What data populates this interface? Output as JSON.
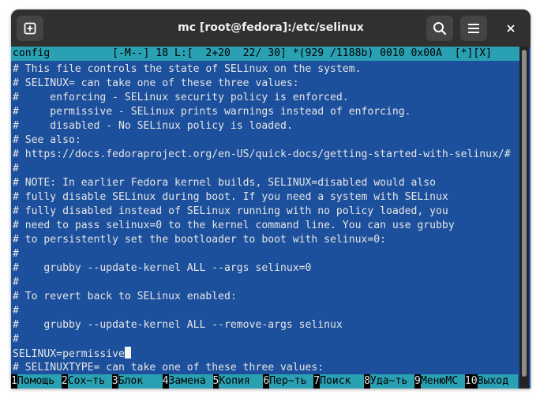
{
  "window": {
    "title": "mc [root@fedora]:/etc/selinux",
    "icons": {
      "new_tab": "new-tab-icon",
      "search": "search-icon",
      "menu": "hamburger-menu-icon",
      "close": "close-icon"
    }
  },
  "editor": {
    "status_line": "config          [-M--] 18 L:[  2+20  22/ 30] *(929 /1188b) 0010 0x00A  [*][X]",
    "lines": [
      "# This file controls the state of SELinux on the system.",
      "# SELINUX= can take one of these three values:",
      "#     enforcing - SELinux security policy is enforced.",
      "#     permissive - SELinux prints warnings instead of enforcing.",
      "#     disabled - No SELinux policy is loaded.",
      "# See also:",
      "# https://docs.fedoraproject.org/en-US/quick-docs/getting-started-with-selinux/#",
      "#",
      "# NOTE: In earlier Fedora kernel builds, SELINUX=disabled would also",
      "# fully disable SELinux during boot. If you need a system with SELinux",
      "# fully disabled instead of SELinux running with no policy loaded, you",
      "# need to pass selinux=0 to the kernel command line. You can use grubby",
      "# to persistently set the bootloader to boot with selinux=0:",
      "#",
      "#    grubby --update-kernel ALL --args selinux=0",
      "#",
      "# To revert back to SELinux enabled:",
      "#",
      "#    grubby --update-kernel ALL --remove-args selinux",
      "#",
      "SELINUX=permissive",
      "# SELINUXTYPE= can take one of these three values:"
    ],
    "cursor_line_index": 20
  },
  "function_keys": [
    {
      "num": "1",
      "label": "Помощь"
    },
    {
      "num": "2",
      "label": "Сох~ть"
    },
    {
      "num": "3",
      "label": "Блок"
    },
    {
      "num": "4",
      "label": "Замена"
    },
    {
      "num": "5",
      "label": "Копия"
    },
    {
      "num": "6",
      "label": "Пер~ть"
    },
    {
      "num": "7",
      "label": "Поиск"
    },
    {
      "num": "8",
      "label": "Уда~ть"
    },
    {
      "num": "9",
      "label": "МенюMC"
    },
    {
      "num": "10",
      "label": "Выход"
    }
  ],
  "colors": {
    "terminal_bg": "#1c4f9c",
    "status_bg": "#2aa1b3",
    "text": "#e6e6e6",
    "titlebar": "#303030"
  }
}
